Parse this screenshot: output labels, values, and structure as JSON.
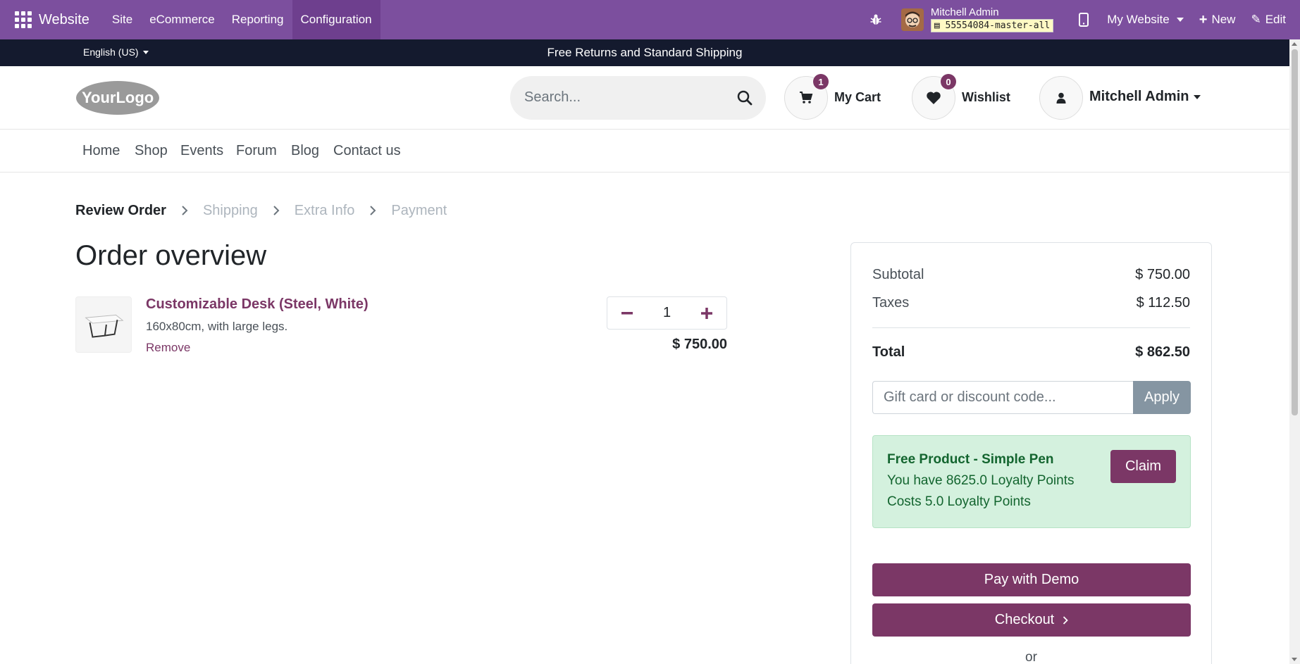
{
  "admin_bar": {
    "app_name": "Website",
    "menu": [
      "Site",
      "eCommerce",
      "Reporting",
      "Configuration"
    ],
    "active_menu": "Configuration",
    "user_name": "Mitchell Admin",
    "database": "55554084-master-all",
    "my_website": "My Website",
    "new_label": "New",
    "edit_label": "Edit",
    "color": "#7c4f9e"
  },
  "announcement": {
    "language": "English (US)",
    "message": "Free Returns and Standard Shipping"
  },
  "header": {
    "logo_text": "YourLogo",
    "search_placeholder": "Search...",
    "cart_label": "My Cart",
    "cart_count": "1",
    "wishlist_label": "Wishlist",
    "wishlist_count": "0",
    "account_name": "Mitchell Admin"
  },
  "nav": [
    "Home",
    "Shop",
    "Events",
    "Forum",
    "Blog",
    "Contact us"
  ],
  "checkout_steps": [
    "Review Order",
    "Shipping",
    "Extra Info",
    "Payment"
  ],
  "page_title": "Order overview",
  "line_item": {
    "name": "Customizable Desk (Steel, White)",
    "description": "160x80cm, with large legs.",
    "remove_label": "Remove",
    "quantity": "1",
    "price": "$ 750.00"
  },
  "summary": {
    "subtotal_label": "Subtotal",
    "subtotal": "$ 750.00",
    "taxes_label": "Taxes",
    "taxes": "$ 112.50",
    "total_label": "Total",
    "total": "$ 862.50",
    "promo_placeholder": "Gift card or discount code...",
    "apply_label": "Apply",
    "reward": {
      "title": "Free Product - Simple Pen",
      "line1": "You have 8625.0 Loyalty Points",
      "line2": "Costs 5.0 Loyalty Points",
      "claim_label": "Claim"
    },
    "pay_label": "Pay with Demo",
    "checkout_label": "Checkout",
    "or_label": "or"
  },
  "colors": {
    "brand": "#7b3766",
    "reward_bg": "#d4f1de",
    "reward_text": "#13652f"
  }
}
